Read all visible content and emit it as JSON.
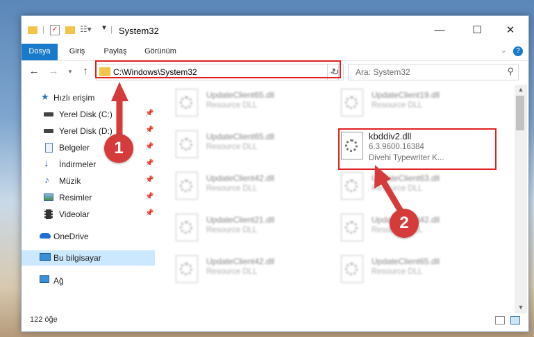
{
  "window": {
    "title": "System32",
    "tabs": [
      "Dosya",
      "Giriş",
      "Paylaş",
      "Görünüm"
    ],
    "help_icon": "?",
    "controls": {
      "minimize": "—",
      "maximize": "☐",
      "close": "✕"
    }
  },
  "address": {
    "path": "C:\\Windows\\System32",
    "search_placeholder": "Ara: System32"
  },
  "sidebar": {
    "quick_access": "Hızlı erişim",
    "items": [
      {
        "label": "Yerel Disk (C:)",
        "icon": "drive-icon"
      },
      {
        "label": "Yerel Disk (D:)",
        "icon": "drive-icon"
      },
      {
        "label": "Belgeler",
        "icon": "documents-icon"
      },
      {
        "label": "İndirmeler",
        "icon": "downloads-icon"
      },
      {
        "label": "Müzik",
        "icon": "music-icon"
      },
      {
        "label": "Resimler",
        "icon": "pictures-icon"
      },
      {
        "label": "Videolar",
        "icon": "videos-icon"
      }
    ],
    "onedrive": "OneDrive",
    "this_pc": "Bu bilgisayar",
    "network": "Ağ"
  },
  "files": {
    "left": [
      {
        "name": "UpdateClient65.dll",
        "desc": "Resource DLL"
      },
      {
        "name": "UpdateClient65.dll",
        "desc": "Resource DLL"
      },
      {
        "name": "UpdateClient42.dll",
        "desc": "Resource DLL"
      },
      {
        "name": "UpdateClient21.dll",
        "desc": "Resource DLL"
      },
      {
        "name": "UpdateClient42.dll",
        "desc": "Resource DLL"
      }
    ],
    "right": [
      {
        "name": "UpdateClient19.dll",
        "desc": "Resource DLL"
      },
      {
        "name": "UpdateClient63.dll",
        "desc": "Resource DLL"
      },
      {
        "name": "UpdateClient42.dll",
        "desc": "Resource DLL"
      },
      {
        "name": "UpdateClient65.dll",
        "desc": "Resource DLL"
      }
    ],
    "highlighted": {
      "name": "kbddiv2.dll",
      "version": "6.3.9600.16384",
      "desc": "Divehi Typewriter K..."
    }
  },
  "status": {
    "count": "122 öğe"
  },
  "annotations": {
    "badge1": "1",
    "badge2": "2",
    "color": "#d63b3b"
  }
}
